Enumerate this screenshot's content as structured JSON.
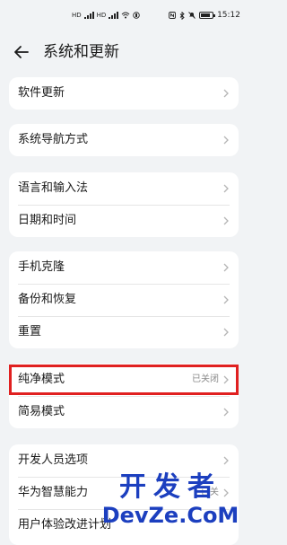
{
  "status_bar": {
    "left_icons": [
      "hd-signal-icon",
      "signal-icon",
      "hd-signal-icon",
      "signal-icon",
      "wifi-icon",
      "sim-status-icon"
    ],
    "right_icons": [
      "nfc-icon",
      "bluetooth-icon",
      "mute-icon",
      "battery-icon"
    ],
    "battery_level": 0.8,
    "time": "15:12"
  },
  "header": {
    "back_icon": "back-arrow-icon",
    "title": "系统和更新"
  },
  "groups": [
    {
      "items": [
        {
          "label": "软件更新"
        }
      ]
    },
    {
      "items": [
        {
          "label": "系统导航方式"
        }
      ]
    },
    {
      "items": [
        {
          "label": "语言和输入法"
        },
        {
          "label": "日期和时间"
        }
      ]
    },
    {
      "items": [
        {
          "label": "手机克隆"
        },
        {
          "label": "备份和恢复"
        },
        {
          "label": "重置"
        }
      ]
    },
    {
      "items": [
        {
          "label": "纯净模式",
          "value": "已关闭"
        },
        {
          "label": "简易模式"
        }
      ]
    },
    {
      "items": [
        {
          "label": "开发人员选项"
        },
        {
          "label": "华为智慧能力",
          "value": "已关"
        },
        {
          "label": "用户体验改进计划"
        }
      ]
    }
  ],
  "watermark": {
    "top": "开发者",
    "bottom": "DevZe.CoM"
  },
  "colors": {
    "background": "#f1f3f5",
    "card": "#ffffff",
    "highlight": "#e02020",
    "watermark": "#1c3fbf"
  }
}
